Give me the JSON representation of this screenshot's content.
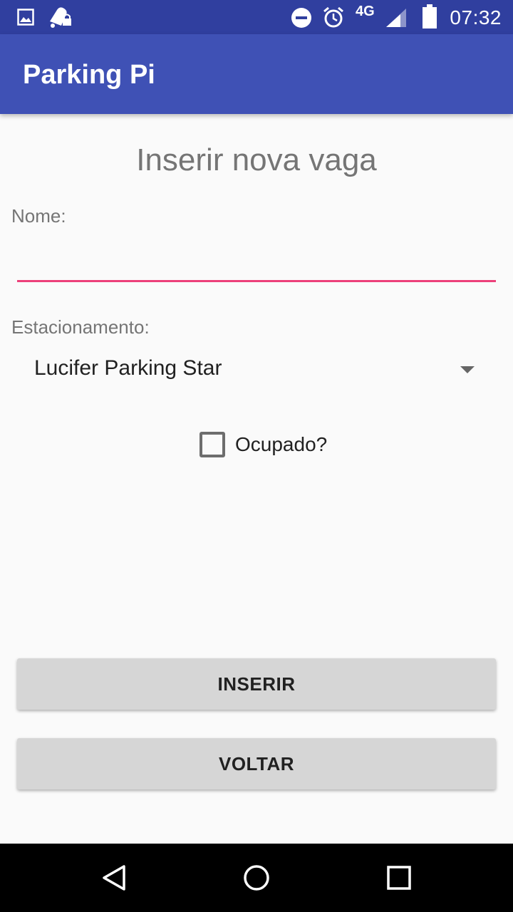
{
  "status_bar": {
    "network": "4G",
    "time": "07:32",
    "icons": [
      "image-icon",
      "notification-bell-lock-icon",
      "do-not-disturb-icon",
      "alarm-icon",
      "signal-icon",
      "battery-icon"
    ]
  },
  "app_bar": {
    "title": "Parking Pi",
    "color": "#3f51b5",
    "status_color": "#303f9f"
  },
  "form": {
    "heading": "Inserir nova vaga",
    "nome_label": "Nome:",
    "nome_value": "",
    "estacionamento_label": "Estacionamento:",
    "estacionamento_selected": "Lucifer Parking Star",
    "ocupado_label": "Ocupado?",
    "ocupado_checked": false,
    "accent_color": "#ec407a"
  },
  "buttons": {
    "inserir": "INSERIR",
    "voltar": "VOLTAR"
  },
  "nav_bar": {
    "icons": [
      "back-icon",
      "home-icon",
      "recents-icon"
    ]
  }
}
